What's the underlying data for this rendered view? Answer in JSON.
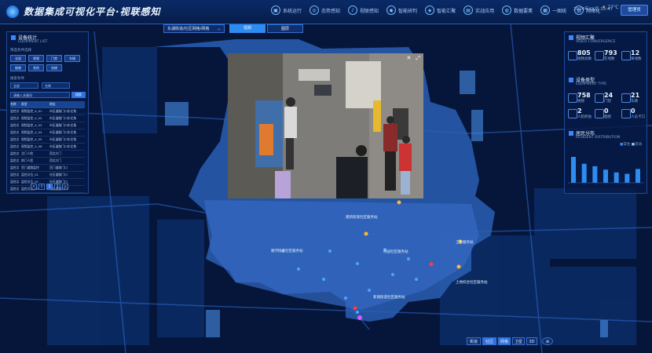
{
  "header": {
    "title": "数据集成可视化平台·视联感知",
    "nav": [
      {
        "label": "系统运行",
        "icon": "monitor-icon"
      },
      {
        "label": "态势感知",
        "icon": "radar-icon"
      },
      {
        "label": "视联感知",
        "icon": "headset-icon"
      },
      {
        "label": "智能研判",
        "icon": "eye-icon"
      },
      {
        "label": "智能汇聚",
        "icon": "shield-icon"
      },
      {
        "label": "实战应用",
        "icon": "chart-icon"
      },
      {
        "label": "数据要素",
        "icon": "globe-icon"
      },
      {
        "label": "一图统",
        "icon": "grid-icon"
      },
      {
        "label": "网格化",
        "icon": "table-icon"
      }
    ],
    "datetime": "2024年XX月 15:47",
    "weather": "27℃",
    "user_button": "管理员"
  },
  "left_panel": {
    "title": "设备统计",
    "subtitle": "EQUIPMENT LIST",
    "filter_label": "筛选条件选择",
    "tags": [
      "全部",
      "视频",
      "门禁",
      "车辆",
      "烟感",
      "其他",
      "电梯"
    ],
    "search_label": "搜索条件",
    "select_1": "全部",
    "select_2": "名称",
    "input_placeholder": "请输入关键词",
    "search_button": "搜索",
    "table_header": [
      "名称",
      "类型",
      "地址"
    ],
    "rows": [
      [
        "监控点",
        "视频监控_X_01",
        "市区道路门口东北角"
      ],
      [
        "监控点",
        "视频监控_X_02",
        "市区道路门口东北角"
      ],
      [
        "监控点",
        "视频监控_X_03",
        "市区道路门口东北角"
      ],
      [
        "监控点",
        "视频监控_X_04",
        "市区道路门口东北角"
      ],
      [
        "监控点",
        "视频监控_X_05",
        "市区道路门口东北角"
      ],
      [
        "监控点",
        "视频监控_X_06",
        "市区道路门口东北角"
      ],
      [
        "监控点",
        "北门人脸",
        "西北大门"
      ],
      [
        "监控点",
        "南门人脸",
        "西北大门"
      ],
      [
        "监控点",
        "西门道路监控",
        "西门道路门口"
      ],
      [
        "监控点",
        "监控点位_01",
        "社区道路门口"
      ],
      [
        "监控点",
        "监控点位_02",
        "社区道路门口"
      ],
      [
        "监控点",
        "监控点位_03",
        "社区道路门口"
      ]
    ],
    "pages": [
      "<",
      "1",
      "2",
      "3",
      ">"
    ]
  },
  "right_panel": {
    "s1_title": "视频汇聚",
    "s1_sub": "VIDEO CONVERGENCE",
    "s1_stats": [
      {
        "value": "805",
        "label": "视频总数"
      },
      {
        "value": "793",
        "label": "在线数"
      },
      {
        "value": "12",
        "label": "离线数"
      }
    ],
    "s2_title": "设备类型",
    "s2_sub": "EQUIPMENT TYPE",
    "s2_stats": [
      {
        "value": "758",
        "label": "视频"
      },
      {
        "value": "24",
        "label": "门禁"
      },
      {
        "value": "21",
        "label": "车辆"
      },
      {
        "value": "2",
        "label": "人脸抓拍"
      },
      {
        "value": "0",
        "label": "烟感"
      },
      {
        "value": "0",
        "label": "人员卡口"
      }
    ],
    "s3_title": "居民分布",
    "s3_sub": "RESIDENT DISTRIBUTION",
    "legend": [
      "常住",
      "流动"
    ]
  },
  "region_select": "东湖街道/社区网格/网格",
  "tabs": {
    "video": "视频",
    "other": "图层"
  },
  "map_labels": [
    "建新街道社区服务站",
    "顺河街道社区服务站",
    "桥园社区服务站",
    "卫生服务站",
    "土地综合社区服务站",
    "新城街道社区服务站"
  ],
  "bottom": [
    "街道",
    "社区",
    "网格",
    "卫星",
    "3D"
  ],
  "colors": {
    "accent": "#2e72e0",
    "panel": "#071a46",
    "map_dark": "#0a2658",
    "map_zone": "#2a5fb4"
  },
  "chart_data": {
    "type": "bar",
    "values": [
      75,
      55,
      48,
      38,
      30,
      26,
      40
    ],
    "ylim": [
      0,
      100
    ]
  }
}
